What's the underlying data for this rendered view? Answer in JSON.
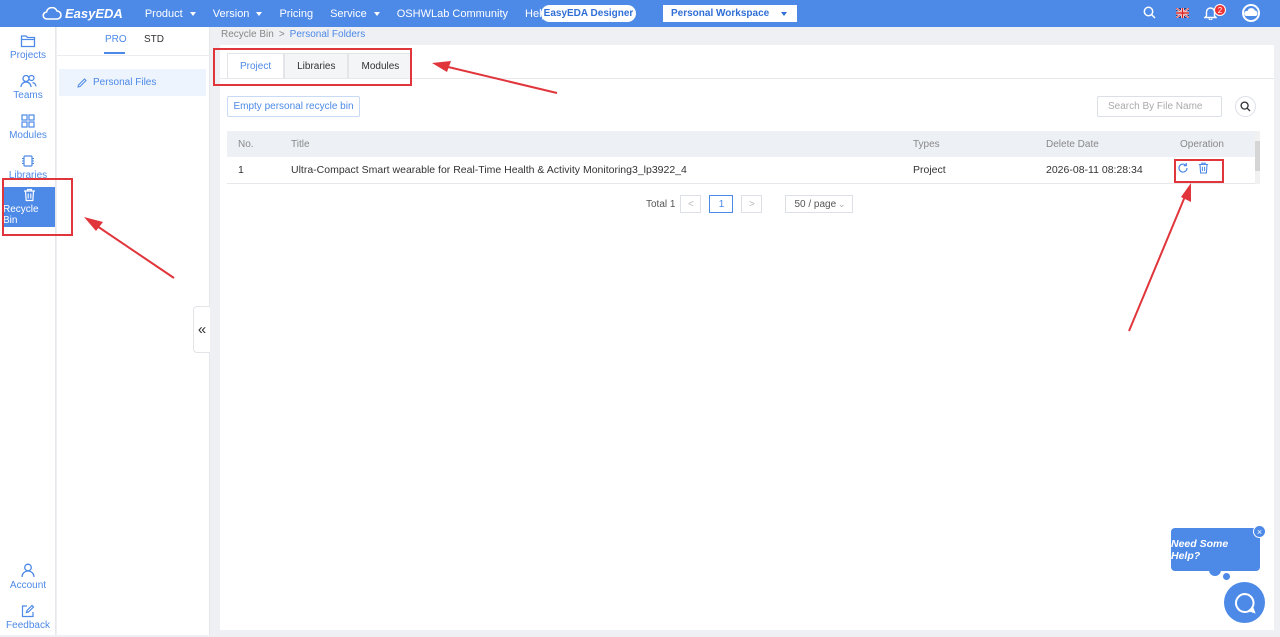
{
  "topbar": {
    "logo": "EasyEDA",
    "nav": [
      {
        "label": "Product",
        "dropdown": true
      },
      {
        "label": "Version",
        "dropdown": true
      },
      {
        "label": "Pricing",
        "dropdown": false
      },
      {
        "label": "Service",
        "dropdown": true
      },
      {
        "label": "OSHWLab Community",
        "dropdown": false
      },
      {
        "label": "Help",
        "dropdown": true
      }
    ],
    "designer_button": "EasyEDA Designer",
    "workspace": "Personal Workspace",
    "notification_count": "2",
    "icons": [
      "search-icon",
      "language-flag-icon",
      "bell-icon",
      "user-avatar-icon"
    ]
  },
  "sidebar": {
    "items": [
      {
        "label": "Projects",
        "icon": "folder-icon"
      },
      {
        "label": "Teams",
        "icon": "teams-icon"
      },
      {
        "label": "Modules",
        "icon": "modules-icon"
      },
      {
        "label": "Libraries",
        "icon": "chip-icon"
      },
      {
        "label": "Recycle Bin",
        "icon": "trash-icon",
        "active": true
      },
      {
        "label": "Account",
        "icon": "user-icon"
      },
      {
        "label": "Feedback",
        "icon": "edit-icon"
      }
    ]
  },
  "subpanel": {
    "tabs": [
      {
        "label": "PRO",
        "active": true
      },
      {
        "label": "STD",
        "active": false
      }
    ],
    "item": "Personal Files",
    "collapse_glyph": "«"
  },
  "breadcrumb": {
    "root": "Recycle Bin",
    "separator": ">",
    "current": "Personal Folders"
  },
  "main": {
    "tabs": [
      {
        "label": "Project",
        "active": true
      },
      {
        "label": "Libraries",
        "active": false
      },
      {
        "label": "Modules",
        "active": false
      }
    ],
    "empty_button": "Empty personal recycle bin",
    "search_placeholder": "Search By File Name",
    "table": {
      "columns": [
        "No.",
        "Title",
        "Types",
        "Delete Date",
        "Operation"
      ],
      "rows": [
        {
          "no": "1",
          "title": "Ultra-Compact Smart wearable for Real-Time Health & Activity Monitoring3_lp3922_4",
          "type": "Project",
          "date": "2026-08-11 08:28:34",
          "operations": [
            "restore-icon",
            "delete-icon"
          ]
        }
      ]
    },
    "pagination": {
      "total": "Total 1",
      "prev": "<",
      "page": "1",
      "next": ">",
      "page_size": "50 / page"
    }
  },
  "help": {
    "bubble": "Need Some Help?",
    "close": "×"
  },
  "colors": {
    "brand": "#4d89e7",
    "highlight": "#e0353b"
  }
}
